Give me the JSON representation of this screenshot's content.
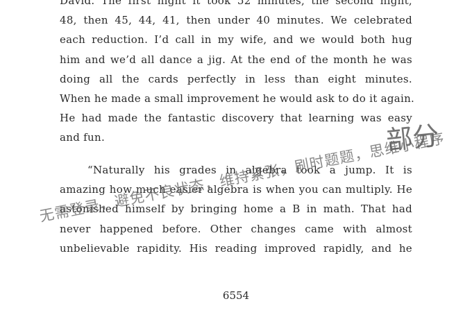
{
  "paragraphs": [
    {
      "lines": [
        "David. The first night it took 52 minutes, the second night,",
        "48, then 45, 44, 41, then under 40 minutes. We celebrated",
        "each reduction. I’d call in my wife, and we would both hug",
        "him and we’d all dance a jig. At the end of the month he was",
        "doing all the cards perfectly in less than eight minutes.",
        "When he made a small improvement he would ask to do it again.",
        "He had made the fantastic discovery that learning was easy",
        "and fun."
      ]
    },
    {
      "lines": [
        "“Naturally his grades in algebra took a jump. It is",
        "amazing how much easier algebra is when you can multiply. He",
        "astonished himself by bringing home a B in math. That had",
        "never happened before. Other changes came with almost",
        "unbelievable rapidity. His reading improved rapidly, and he"
      ]
    }
  ],
  "page_number": "6554",
  "watermark": {
    "main": "无需登录，避免不良状态，维持紧张，刷时题题，思维小程序",
    "corner": "部分"
  }
}
